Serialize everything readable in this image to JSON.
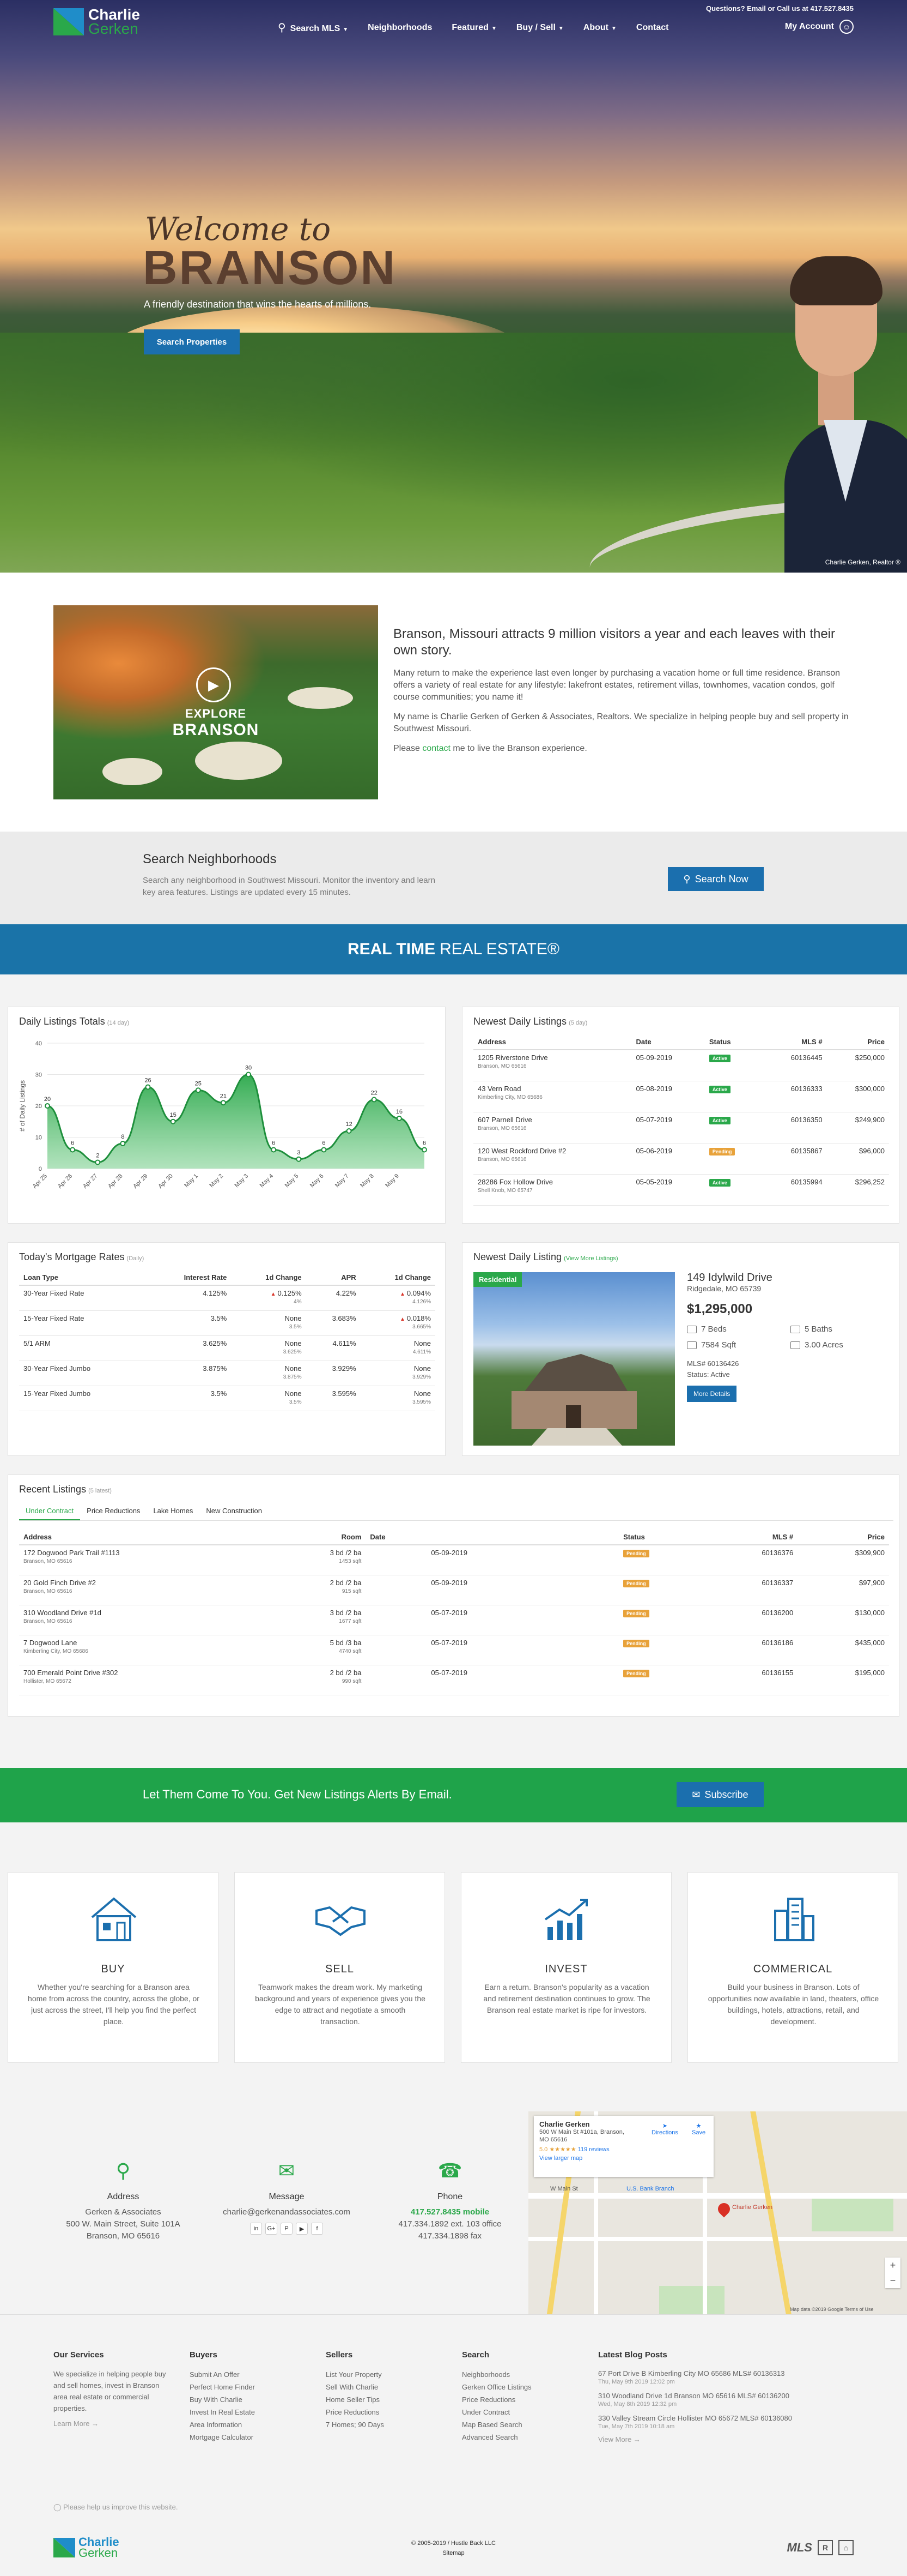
{
  "header": {
    "logo_line1": "Charlie",
    "logo_line2": "Gerken",
    "top_contact": "Questions? Email or Call us at 417.527.8435",
    "nav": [
      {
        "label": "Search MLS",
        "chev": true
      },
      {
        "label": "Neighborhoods",
        "chev": false
      },
      {
        "label": "Featured",
        "chev": true
      },
      {
        "label": "Buy / Sell",
        "chev": true
      },
      {
        "label": "About",
        "chev": true
      },
      {
        "label": "Contact",
        "chev": false
      }
    ],
    "account": "My Account"
  },
  "hero": {
    "welcome": "Welcome to",
    "city": "BRANSON",
    "tagline": "A friendly destination that wins the hearts of millions.",
    "button": "Search Properties",
    "credit": "Charlie Gerken, Realtor ®"
  },
  "intro": {
    "video_line1": "EXPLORE",
    "video_line2": "BRANSON",
    "heading": "Branson, Missouri attracts 9 million visitors a year and each leaves with their own story.",
    "p1": "Many return to make the experience last even longer by purchasing a vacation home or full time residence. Branson offers a variety of real estate for any lifestyle: lakefront estates, retirement villas, townhomes, vacation condos, golf course communities; you name it!",
    "p2": "My name is Charlie Gerken of Gerken & Associates, Realtors. We specialize in helping people buy and sell property in Southwest Missouri.",
    "p3_pre": "Please ",
    "p3_link": "contact",
    "p3_post": " me to live the Branson experience."
  },
  "search_neighborhoods": {
    "title": "Search Neighborhoods",
    "text": "Search any neighborhood in Southwest Missouri. Monitor the inventory and learn key area features. Listings are updated every 15 minutes.",
    "button": "Search Now"
  },
  "realtime": {
    "bold": "REAL TIME",
    "rest": "REAL ESTATE®"
  },
  "daily_totals": {
    "title": "Daily Listings Totals",
    "sub": "(14 day)"
  },
  "chart_data": {
    "type": "area",
    "title": "Daily Listings Totals",
    "ylabel": "# of Daily Listings",
    "categories": [
      "Apr 25",
      "Apr 26",
      "Apr 27",
      "Apr 28",
      "Apr 29",
      "Apr 30",
      "May 1",
      "May 2",
      "May 3",
      "May 4",
      "May 5",
      "May 6",
      "May 7",
      "May 8",
      "May 9"
    ],
    "values": [
      20,
      6,
      2,
      8,
      26,
      15,
      25,
      21,
      30,
      6,
      3,
      6,
      12,
      22,
      16,
      6
    ],
    "ylim": [
      0,
      40
    ],
    "yticks": [
      0,
      10,
      20,
      30,
      40
    ],
    "color": "#2aa84a"
  },
  "newest_daily": {
    "title": "Newest Daily Listings",
    "sub": "(5 day)",
    "headers": [
      "Address",
      "Date",
      "Status",
      "MLS #",
      "Price"
    ],
    "rows": [
      {
        "addr": "1205 Riverstone Drive",
        "city": "Branson, MO 65616",
        "date": "05-09-2019",
        "status": "Active",
        "mls": "60136445",
        "price": "$250,000"
      },
      {
        "addr": "43 Vern Road",
        "city": "Kimberling City, MO 65686",
        "date": "05-08-2019",
        "status": "Active",
        "mls": "60136333",
        "price": "$300,000"
      },
      {
        "addr": "607 Parnell Drive",
        "city": "Branson, MO 65616",
        "date": "05-07-2019",
        "status": "Active",
        "mls": "60136350",
        "price": "$249,900"
      },
      {
        "addr": "120 West Rockford Drive #2",
        "city": "Branson, MO 65616",
        "date": "05-06-2019",
        "status": "Pending",
        "mls": "60135867",
        "price": "$96,000"
      },
      {
        "addr": "28286 Fox Hollow Drive",
        "city": "Shell Knob, MO 65747",
        "date": "05-05-2019",
        "status": "Active",
        "mls": "60135994",
        "price": "$296,252"
      }
    ]
  },
  "mortgage": {
    "title": "Today's Mortgage Rates",
    "sub": "(Daily)",
    "headers": [
      "Loan Type",
      "Interest Rate",
      "1d Change",
      "APR",
      "1d Change"
    ],
    "rows": [
      {
        "type": "30-Year Fixed Rate",
        "rate": "4.125%",
        "c1": "0.125%",
        "c1s": "4%",
        "c1up": true,
        "apr": "4.22%",
        "c2": "0.094%",
        "c2s": "4.126%",
        "c2up": true
      },
      {
        "type": "15-Year Fixed Rate",
        "rate": "3.5%",
        "c1": "None",
        "c1s": "3.5%",
        "c1up": false,
        "apr": "3.683%",
        "c2": "0.018%",
        "c2s": "3.665%",
        "c2up": true
      },
      {
        "type": "5/1 ARM",
        "rate": "3.625%",
        "c1": "None",
        "c1s": "3.625%",
        "c1up": false,
        "apr": "4.611%",
        "c2": "None",
        "c2s": "4.611%",
        "c2up": false
      },
      {
        "type": "30-Year Fixed Jumbo",
        "rate": "3.875%",
        "c1": "None",
        "c1s": "3.875%",
        "c1up": false,
        "apr": "3.929%",
        "c2": "None",
        "c2s": "3.929%",
        "c2up": false
      },
      {
        "type": "15-Year Fixed Jumbo",
        "rate": "3.5%",
        "c1": "None",
        "c1s": "3.5%",
        "c1up": false,
        "apr": "3.595%",
        "c2": "None",
        "c2s": "3.595%",
        "c2up": false
      }
    ]
  },
  "newest_listing": {
    "title": "Newest Daily Listing",
    "view_more": "(View More Listings)",
    "tag": "Residential",
    "addr": "149 Idylwild Drive",
    "city": "Ridgedale, MO 65739",
    "price": "$1,295,000",
    "beds": "7 Beds",
    "baths": "5 Baths",
    "sqft": "7584 Sqft",
    "acres": "3.00 Acres",
    "mls": "MLS# 60136426",
    "status": "Status: Active",
    "button": "More Details"
  },
  "recent": {
    "title": "Recent Listings",
    "sub": "(5 latest)",
    "tabs": [
      "Under Contract",
      "Price Reductions",
      "Lake Homes",
      "New Construction"
    ],
    "headers": [
      "Address",
      "Room",
      "Date",
      "Status",
      "MLS #",
      "Price"
    ],
    "rows": [
      {
        "addr": "172 Dogwood Park Trail #1113",
        "city": "Branson, MO 65616",
        "room": "3 bd /2 ba",
        "sqft": "1453 sqft",
        "date": "05-09-2019",
        "status": "Pending",
        "mls": "60136376",
        "price": "$309,900"
      },
      {
        "addr": "20 Gold Finch Drive #2",
        "city": "Branson, MO 65616",
        "room": "2 bd /2 ba",
        "sqft": "915 sqft",
        "date": "05-09-2019",
        "status": "Pending",
        "mls": "60136337",
        "price": "$97,900"
      },
      {
        "addr": "310 Woodland Drive #1d",
        "city": "Branson, MO 65616",
        "room": "3 bd /2 ba",
        "sqft": "1677 sqft",
        "date": "05-07-2019",
        "status": "Pending",
        "mls": "60136200",
        "price": "$130,000"
      },
      {
        "addr": "7 Dogwood Lane",
        "city": "Kimberling City, MO 65686",
        "room": "5 bd /3 ba",
        "sqft": "4740 sqft",
        "date": "05-07-2019",
        "status": "Pending",
        "mls": "60136186",
        "price": "$435,000"
      },
      {
        "addr": "700 Emerald Point Drive #302",
        "city": "Hollister, MO 65672",
        "room": "2 bd /2 ba",
        "sqft": "990 sqft",
        "date": "05-07-2019",
        "status": "Pending",
        "mls": "60136155",
        "price": "$195,000"
      }
    ]
  },
  "subscribe": {
    "text": "Let Them Come To You. Get New Listings Alerts By Email.",
    "button": "Subscribe"
  },
  "cards": [
    {
      "title": "BUY",
      "text": "Whether you're searching for a Branson area home from across the country, across the globe, or just across the street, I'll help you find the perfect place.",
      "icon": "house-icon"
    },
    {
      "title": "SELL",
      "text": "Teamwork makes the dream work. My marketing background and years of experience gives you the edge to attract and negotiate a smooth transaction.",
      "icon": "handshake-icon"
    },
    {
      "title": "INVEST",
      "text": "Earn a return. Branson's popularity as a vacation and retirement destination continues to grow. The Branson real estate market is ripe for investors.",
      "icon": "growth-chart-icon"
    },
    {
      "title": "COMMERICAL",
      "text": "Build your business in Branson. Lots of opportunities now available in land, theaters, office buildings, hotels, attractions, retail, and development.",
      "icon": "buildings-icon"
    }
  ],
  "contact": {
    "address": {
      "title": "Address",
      "l1": "Gerken & Associates",
      "l2": "500 W. Main Street, Suite 101A",
      "l3": "Branson, MO 65616"
    },
    "message": {
      "title": "Message",
      "email": "charlie@gerkenandassociates.com"
    },
    "phone": {
      "title": "Phone",
      "mobile": "417.527.8435 mobile",
      "office": "417.334.1892 ext. 103 office",
      "fax": "417.334.1898 fax"
    }
  },
  "map": {
    "name": "Charlie Gerken",
    "addr": "500 W Main St #101a, Branson, MO 65616",
    "rating": "5.0 ★★★★★",
    "reviews": "119 reviews",
    "larger": "View larger map",
    "directions": "Directions",
    "save": "Save",
    "pin_label": "Charlie Gerken",
    "street": "W Main St",
    "bank": "U.S. Bank Branch",
    "footer": "Map data ©2019 Google   Terms of Use"
  },
  "footer": {
    "services": {
      "title": "Our Services",
      "text": "We specialize in helping people buy and sell homes, invest in Branson area real estate or commercial properties.",
      "more": "Learn More →"
    },
    "buyers": {
      "title": "Buyers",
      "links": [
        "Submit An Offer",
        "Perfect Home Finder",
        "Buy With Charlie",
        "Invest In Real Estate",
        "Area Information",
        "Mortgage Calculator"
      ]
    },
    "sellers": {
      "title": "Sellers",
      "links": [
        "List Your Property",
        "Sell With Charlie",
        "Home Seller Tips",
        "Price Reductions",
        "7 Homes; 90 Days"
      ]
    },
    "search": {
      "title": "Search",
      "links": [
        "Neighborhoods",
        "Gerken Office Listings",
        "Price Reductions",
        "Under Contract",
        "Map Based Search",
        "Advanced Search"
      ]
    },
    "blog": {
      "title": "Latest Blog Posts",
      "posts": [
        {
          "t": "67 Port Drive B Kimberling City MO 65686 MLS# 60136313",
          "d": "Thu, May 9th 2019 12:02 pm"
        },
        {
          "t": "310 Woodland Drive 1d Branson MO 65616 MLS# 60136200",
          "d": "Wed, May 8th 2019 12:32 pm"
        },
        {
          "t": "330 Valley Stream Circle Hollister MO 65672 MLS# 60136080",
          "d": "Tue, May 7th 2019 10:18 am"
        }
      ],
      "more": "View More →"
    },
    "feedback": "Please help us improve this website.",
    "copyright": "© 2005-2019 / Hustle Back LLC",
    "sitemap": "Sitemap"
  }
}
